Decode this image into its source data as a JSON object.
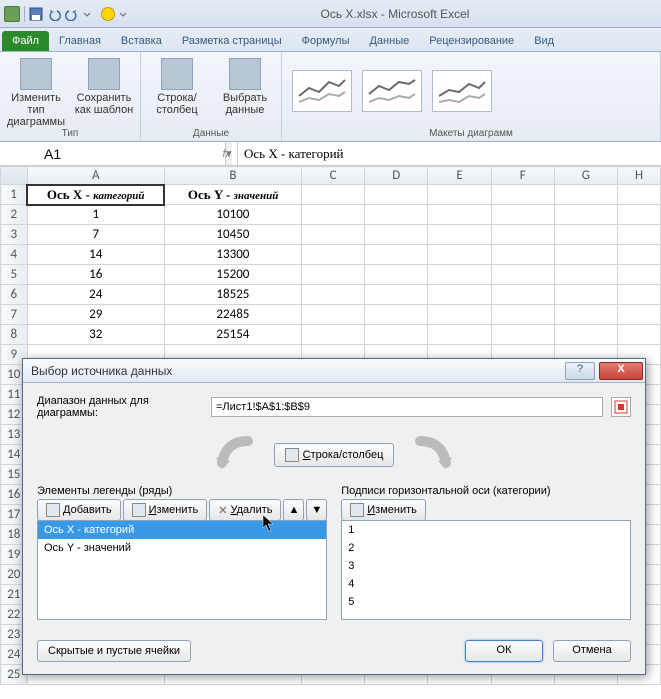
{
  "titlebar": {
    "title": "Ось X.xlsx  -  Microsoft Excel"
  },
  "tabs": {
    "file": "Файл",
    "home": "Главная",
    "insert": "Вставка",
    "layout": "Разметка страницы",
    "formulas": "Формулы",
    "data": "Данные",
    "review": "Рецензирование",
    "view": "Вид"
  },
  "ribbon": {
    "change_type": "Изменить тип диаграммы",
    "save_template": "Сохранить как шаблон",
    "type_group": "Тип",
    "switch_rc": "Строка/столбец",
    "select_data": "Выбрать данные",
    "data_group": "Данные",
    "layouts_group": "Макеты диаграмм"
  },
  "namebox": {
    "value": "A1"
  },
  "formula": {
    "fx": "fx",
    "value": "Ось X - категорий"
  },
  "grid": {
    "cols": [
      "A",
      "B",
      "C",
      "D",
      "E",
      "F",
      "G",
      "H"
    ],
    "rows": [
      "1",
      "2",
      "3",
      "4",
      "5",
      "6",
      "7",
      "8",
      "9",
      "10",
      "11",
      "12",
      "13",
      "14",
      "15",
      "16",
      "17",
      "18",
      "19",
      "20",
      "21",
      "22",
      "23",
      "24",
      "25"
    ],
    "header_a_pre": "Ось X - ",
    "header_a_ital": "категорий",
    "header_b_pre": "Ось Y - ",
    "header_b_ital": "значений",
    "data": [
      [
        "1",
        "10100"
      ],
      [
        "7",
        "10450"
      ],
      [
        "14",
        "13300"
      ],
      [
        "16",
        "15200"
      ],
      [
        "24",
        "18525"
      ],
      [
        "29",
        "22485"
      ],
      [
        "32",
        "25154"
      ]
    ]
  },
  "dialog": {
    "title": "Выбор источника данных",
    "help": "?",
    "close": "X",
    "range_label_pre": "Диапазон данных для диаграммы:",
    "range_value": "=Лист1!$A$1:$B$9",
    "swap_label_pre": "Строка/столбец",
    "left_section_pre": "Элементы легенды (ряды)",
    "right_section_pre": "Подписи горизонтальной оси (категории)",
    "add_btn_pre": "Добавить",
    "edit_btn_pre": "Изменить",
    "delete_btn_pre": "Удалить",
    "up": "▲",
    "down": "▼",
    "series": [
      "Ось X - категорий",
      "Ось Y - значений"
    ],
    "categories": [
      "1",
      "2",
      "3",
      "4",
      "5"
    ],
    "hidden_cells": "Скрытые и пустые ячейки",
    "ok": "ОК",
    "cancel": "Отмена"
  }
}
